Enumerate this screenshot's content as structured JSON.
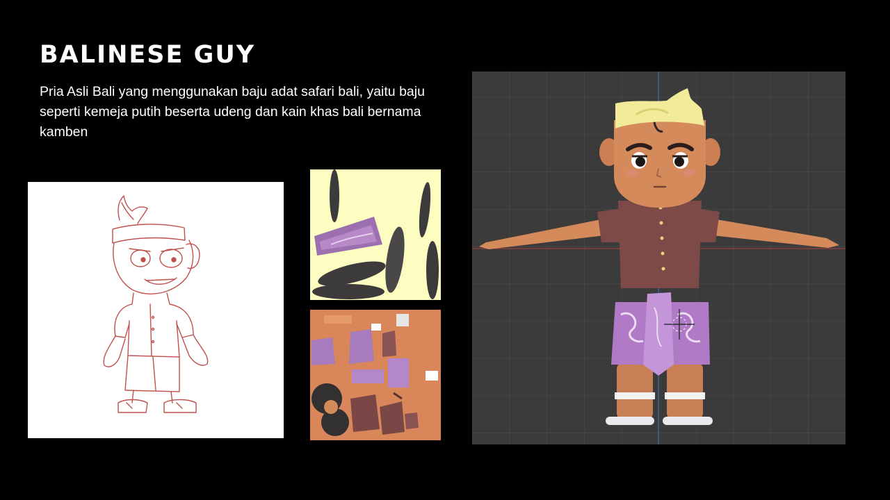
{
  "slide": {
    "title": "BALINESE GUY",
    "description": "Pria Asli Bali yang menggunakan baju adat safari bali, yaitu baju seperti kemeja putih beserta udeng dan kain khas bali bernama kamben"
  },
  "panels": {
    "sketch": "red pencil character concept sketch",
    "texture_hair": "hair texture atlas",
    "texture_body": "body texture atlas",
    "viewport": "3D model viewport (T-pose)"
  },
  "colors": {
    "background": "#000000",
    "text": "#ffffff",
    "sketch_line": "#c0504d",
    "udeng": "#f2eb9a",
    "shirt": "#7e4a47",
    "kamben": "#b07ac7",
    "skin": "#d58a5c",
    "viewport_bg": "#3b3b3b"
  }
}
